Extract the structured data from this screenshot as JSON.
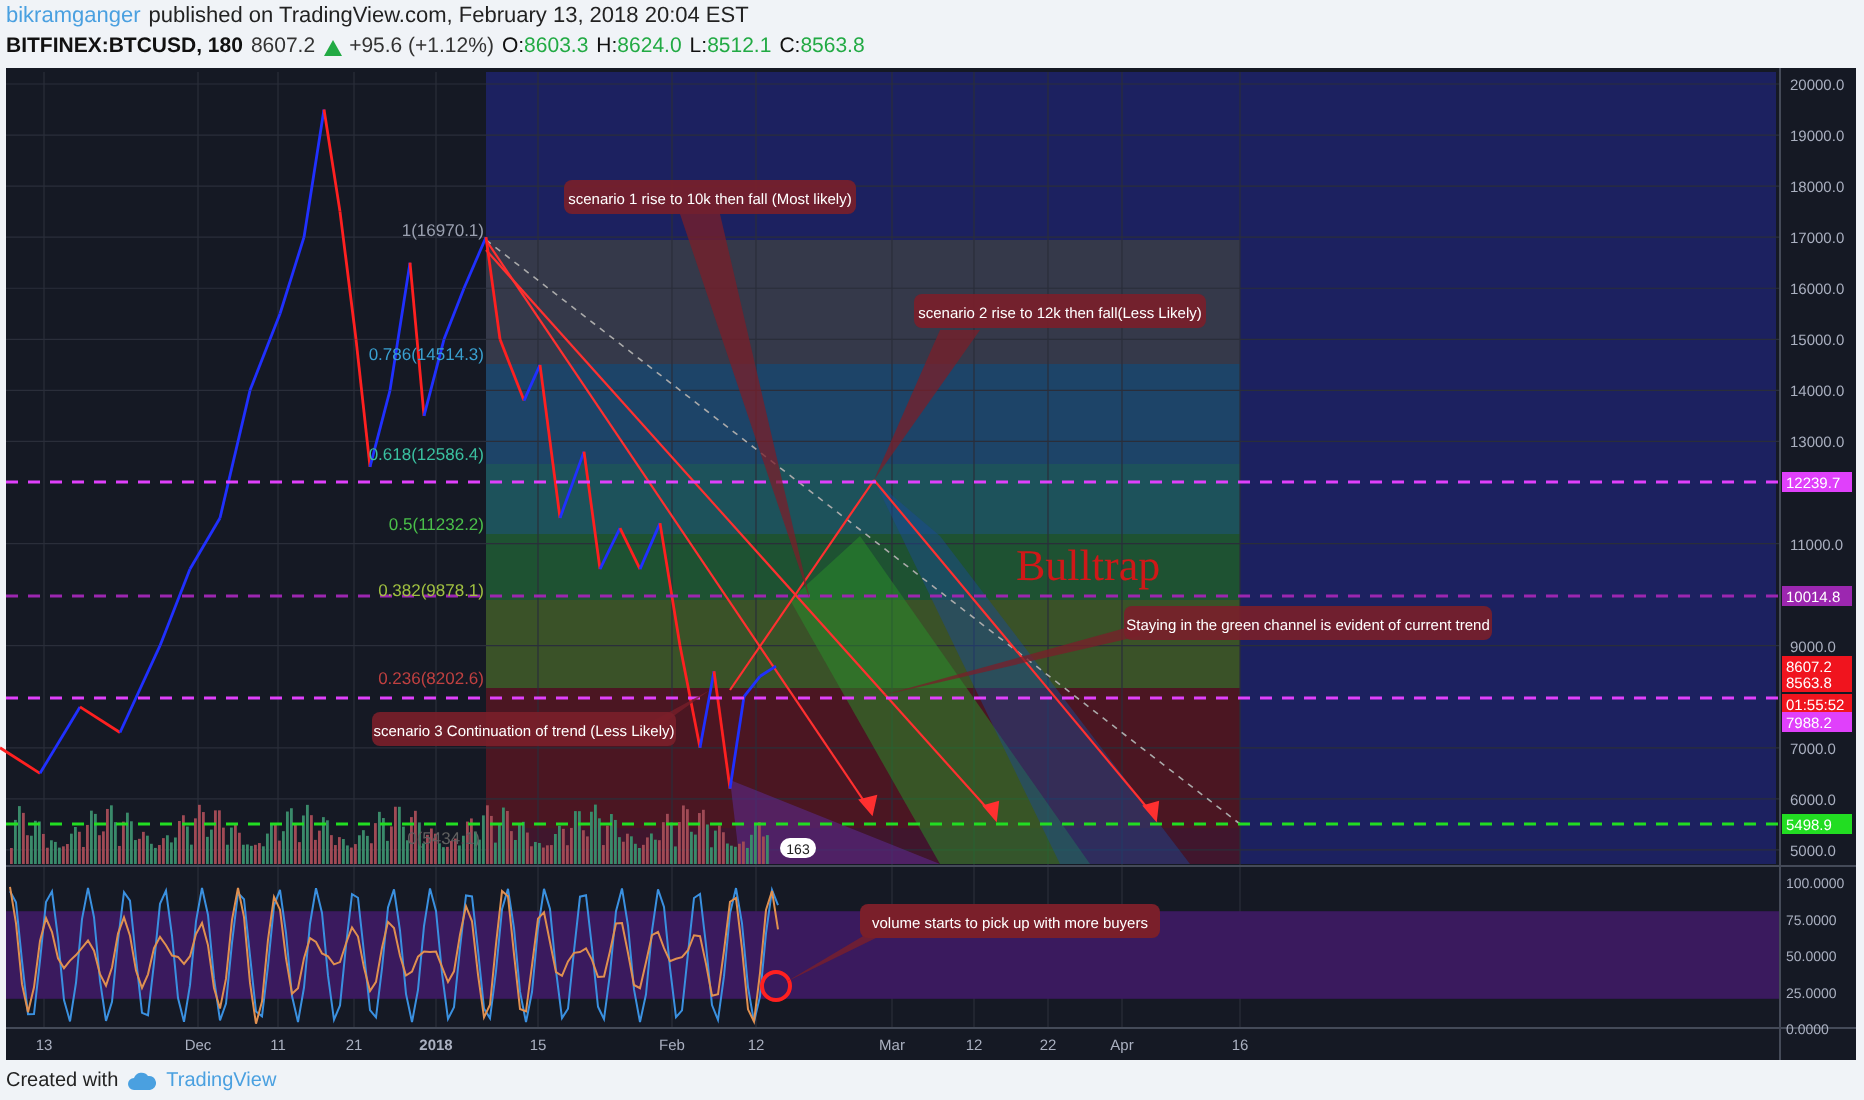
{
  "header": {
    "author": "bikramganger",
    "published": "published on TradingView.com, February 13, 2018 20:04 EST"
  },
  "symbol": {
    "name": "BITFINEX:BTCUSD, 180",
    "last": "8607.2",
    "change": "+95.6 (+1.12%)",
    "ohlc": [
      {
        "label": "O:",
        "value": "8603.3"
      },
      {
        "label": "H:",
        "value": "8624.0"
      },
      {
        "label": "L:",
        "value": "8512.1"
      },
      {
        "label": "C:",
        "value": "8563.8"
      }
    ]
  },
  "price_axis": [
    "20000.0",
    "19000.0",
    "18000.0",
    "17000.0",
    "16000.0",
    "15000.0",
    "14000.0",
    "13000.0",
    "11000.0",
    "9000.0",
    "7000.0",
    "6000.0",
    "5000.0"
  ],
  "price_tags": [
    {
      "value": "12239.7",
      "color": "#e040fb"
    },
    {
      "value": "10014.8",
      "color": "#9c27b0"
    },
    {
      "value": "8607.2",
      "color": "#f0141e"
    },
    {
      "value": "8563.8",
      "color": "#f0141e"
    },
    {
      "value": "01:55:52",
      "color": "#f0141e"
    },
    {
      "value": "7988.2",
      "color": "#e040fb"
    },
    {
      "value": "5498.9",
      "color": "#22dd22"
    }
  ],
  "fib_levels": [
    {
      "label": "1(16970.1)"
    },
    {
      "label": "0.786(14514.3)"
    },
    {
      "label": "0.618(12586.4)"
    },
    {
      "label": "0.5(11232.2)"
    },
    {
      "label": "0.382(9878.1)"
    },
    {
      "label": "0.236(8202.6)"
    },
    {
      "label": "0(5434.1)"
    }
  ],
  "annotations": [
    {
      "text": "scenario 1 rise to 10k then fall (Most likely)"
    },
    {
      "text": "scenario 2 rise to 12k then fall(Less Likely)"
    },
    {
      "text": "Staying in the green channel is evident of current trend"
    },
    {
      "text": "scenario 3 Continuation of trend (Less Likely)"
    }
  ],
  "bulltrap": "Bulltrap",
  "badge": "163",
  "indicator": {
    "axis": [
      "100.0000",
      "75.0000",
      "50.0000",
      "25.0000",
      "0.0000"
    ],
    "callout": "volume starts to pick up with more buyers"
  },
  "time_axis": [
    {
      "label": "13",
      "bold": false
    },
    {
      "label": "Dec",
      "bold": false
    },
    {
      "label": "11",
      "bold": false
    },
    {
      "label": "21",
      "bold": false
    },
    {
      "label": "2018",
      "bold": true
    },
    {
      "label": "15",
      "bold": false
    },
    {
      "label": "Feb",
      "bold": false
    },
    {
      "label": "12",
      "bold": false
    },
    {
      "label": "Mar",
      "bold": false
    },
    {
      "label": "12",
      "bold": false
    },
    {
      "label": "22",
      "bold": false
    },
    {
      "label": "Apr",
      "bold": false
    },
    {
      "label": "16",
      "bold": false
    }
  ],
  "footer": {
    "created": "Created with",
    "brand": "TradingView"
  }
}
